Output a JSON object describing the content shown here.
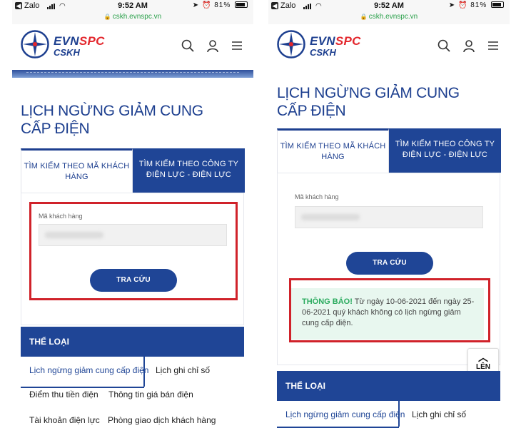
{
  "status_bar": {
    "carrier": "Zalo",
    "time": "9:52 AM",
    "battery": "81%",
    "url": "cskh.evnspc.vn"
  },
  "header": {
    "logo_primary": "EVN",
    "logo_accent": "SPC",
    "logo_sub": "CSKH"
  },
  "page": {
    "title": "LỊCH NGỪNG GIẢM CUNG CẤP ĐIỆN",
    "tabs": [
      {
        "label": "TÌM KIẾM THEO MÃ KHÁCH HÀNG"
      },
      {
        "label": "TÌM KIẾM THEO CÔNG TY ĐIỆN LỰC - ĐIỆN LỰC"
      }
    ],
    "form": {
      "field_label": "Mã khách hàng",
      "submit_label": "TRA CỨU"
    },
    "notice": {
      "heading": "THÔNG BÁO!",
      "text": "Từ ngày 10-06-2021 đến ngày 25-06-2021 quý khách không có lịch ngừng giảm cung cấp điện."
    },
    "category": {
      "title": "THỂ LOẠI",
      "items": [
        "Lịch ngừng giảm cung cấp điện",
        "Lịch ghi chỉ số",
        "Điểm thu tiền điện",
        "Thông tin giá bán điện",
        "Tài khoản điện lực",
        "Phòng giao dịch khách hàng"
      ]
    },
    "scroll_top_label": "LÊN"
  },
  "colors": {
    "brand_blue": "#1f4596",
    "brand_red": "#e3262c",
    "notice_green": "#2bab5f",
    "highlight_red": "#d0222a"
  }
}
